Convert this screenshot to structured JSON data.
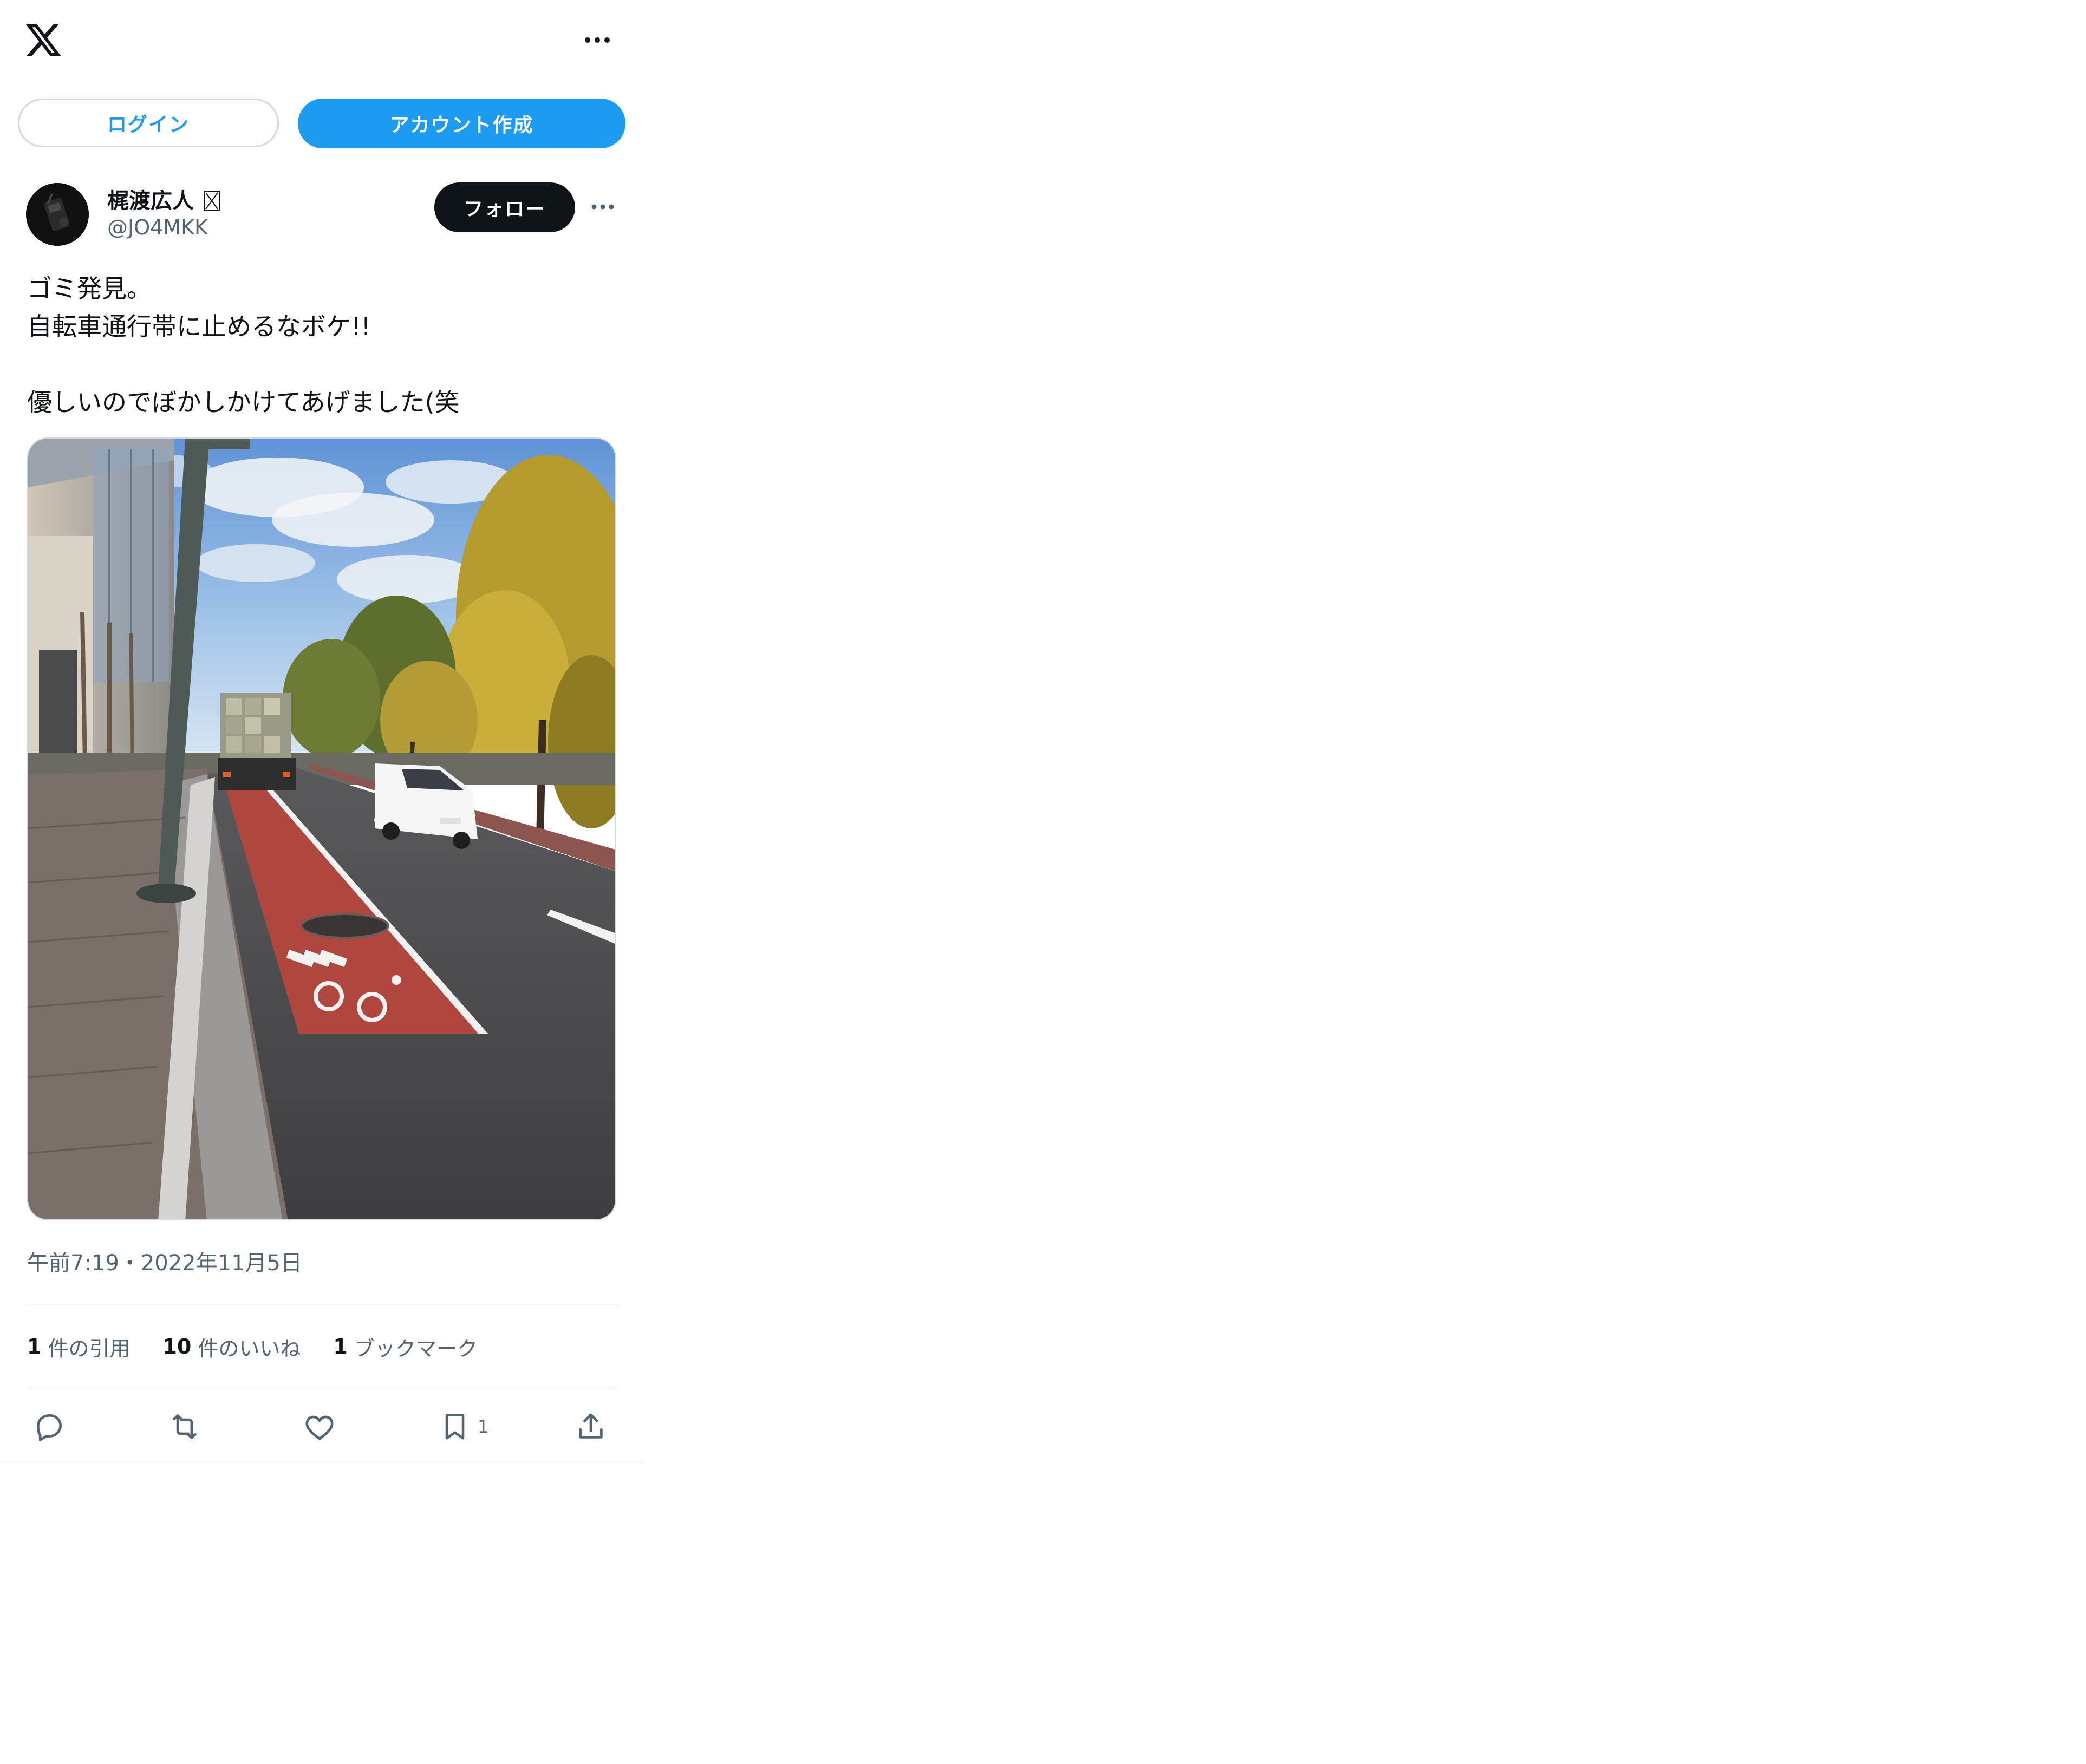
{
  "topbar": {
    "logo_icon": "x-logo-icon",
    "more_icon": "more-horizontal-icon"
  },
  "auth": {
    "login_label": "ログイン",
    "signup_label": "アカウント作成"
  },
  "tweet": {
    "author": {
      "display_name": "梶渡広人",
      "handle": "@JO4MKK"
    },
    "follow_label": "フォロー",
    "text_lines": [
      "ゴミ発見。",
      "自転車通行帯に止めるなボケ!!",
      "",
      "優しいのでぼかしかけてあげました(笑"
    ],
    "timestamp": "午前7:19・2022年11月5日",
    "stats": {
      "quotes_count": "1",
      "quotes_label": "件の引用",
      "likes_count": "10",
      "likes_label": "件のいいね",
      "bookmarks_count": "1",
      "bookmarks_label": "ブックマーク"
    },
    "actions": {
      "bookmark_count": "1"
    }
  },
  "colors": {
    "accent": "#1d9bf0",
    "text_primary": "#0f1419",
    "text_secondary": "#536471",
    "border": "#cfd9de",
    "divider": "#eff3f4"
  }
}
